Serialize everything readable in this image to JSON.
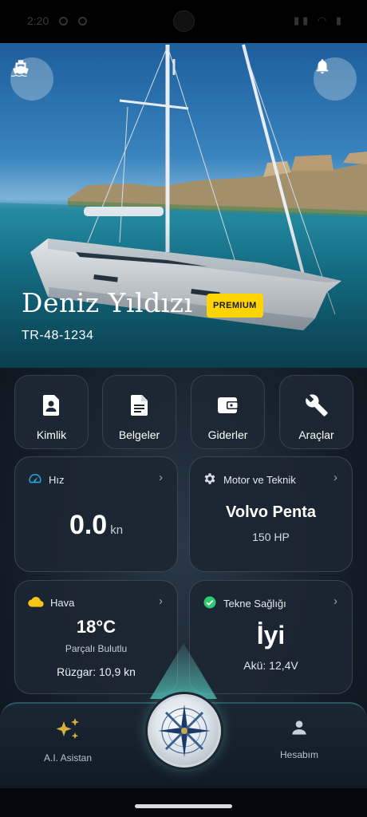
{
  "status_bar": {
    "time": "2:20"
  },
  "hero": {
    "boat_name": "Deniz Yıldızı",
    "badge": "PREMIUM",
    "registration": "TR-48-1234",
    "left_icon": "boat-icon",
    "right_icon": "bell-icon"
  },
  "quick_actions": [
    {
      "label": "Kimlik",
      "icon": "id-card-icon"
    },
    {
      "label": "Belgeler",
      "icon": "document-icon"
    },
    {
      "label": "Giderler",
      "icon": "wallet-icon"
    },
    {
      "label": "Araçlar",
      "icon": "wrench-icon"
    }
  ],
  "cards": {
    "speed": {
      "title": "Hız",
      "value": "0.0",
      "unit": "kn",
      "icon": "speedometer-icon"
    },
    "engine": {
      "title": "Motor ve Teknik",
      "brand": "Volvo Penta",
      "power": "150 HP",
      "icon": "gear-icon"
    },
    "weather": {
      "title": "Hava",
      "temperature": "18°C",
      "condition": "Parçalı Bulutlu",
      "wind": "Rüzgar: 10,9 kn",
      "icon": "cloud-icon"
    },
    "health": {
      "title": "Tekne Sağlığı",
      "status": "İyi",
      "battery": "Akü: 12,4V",
      "icon": "check-circle-icon"
    }
  },
  "bottom_nav": {
    "left": {
      "label": "A.I. Asistan",
      "icon": "sparkles-icon"
    },
    "center": {
      "icon": "compass-icon"
    },
    "right": {
      "label": "Hesabım",
      "icon": "person-icon"
    }
  },
  "colors": {
    "premium_badge": "#ffd400",
    "speed_icon": "#29a9e0",
    "weather_icon": "#f5c518",
    "health_icon": "#2ecc71",
    "sparkles": "#d4b13a"
  }
}
